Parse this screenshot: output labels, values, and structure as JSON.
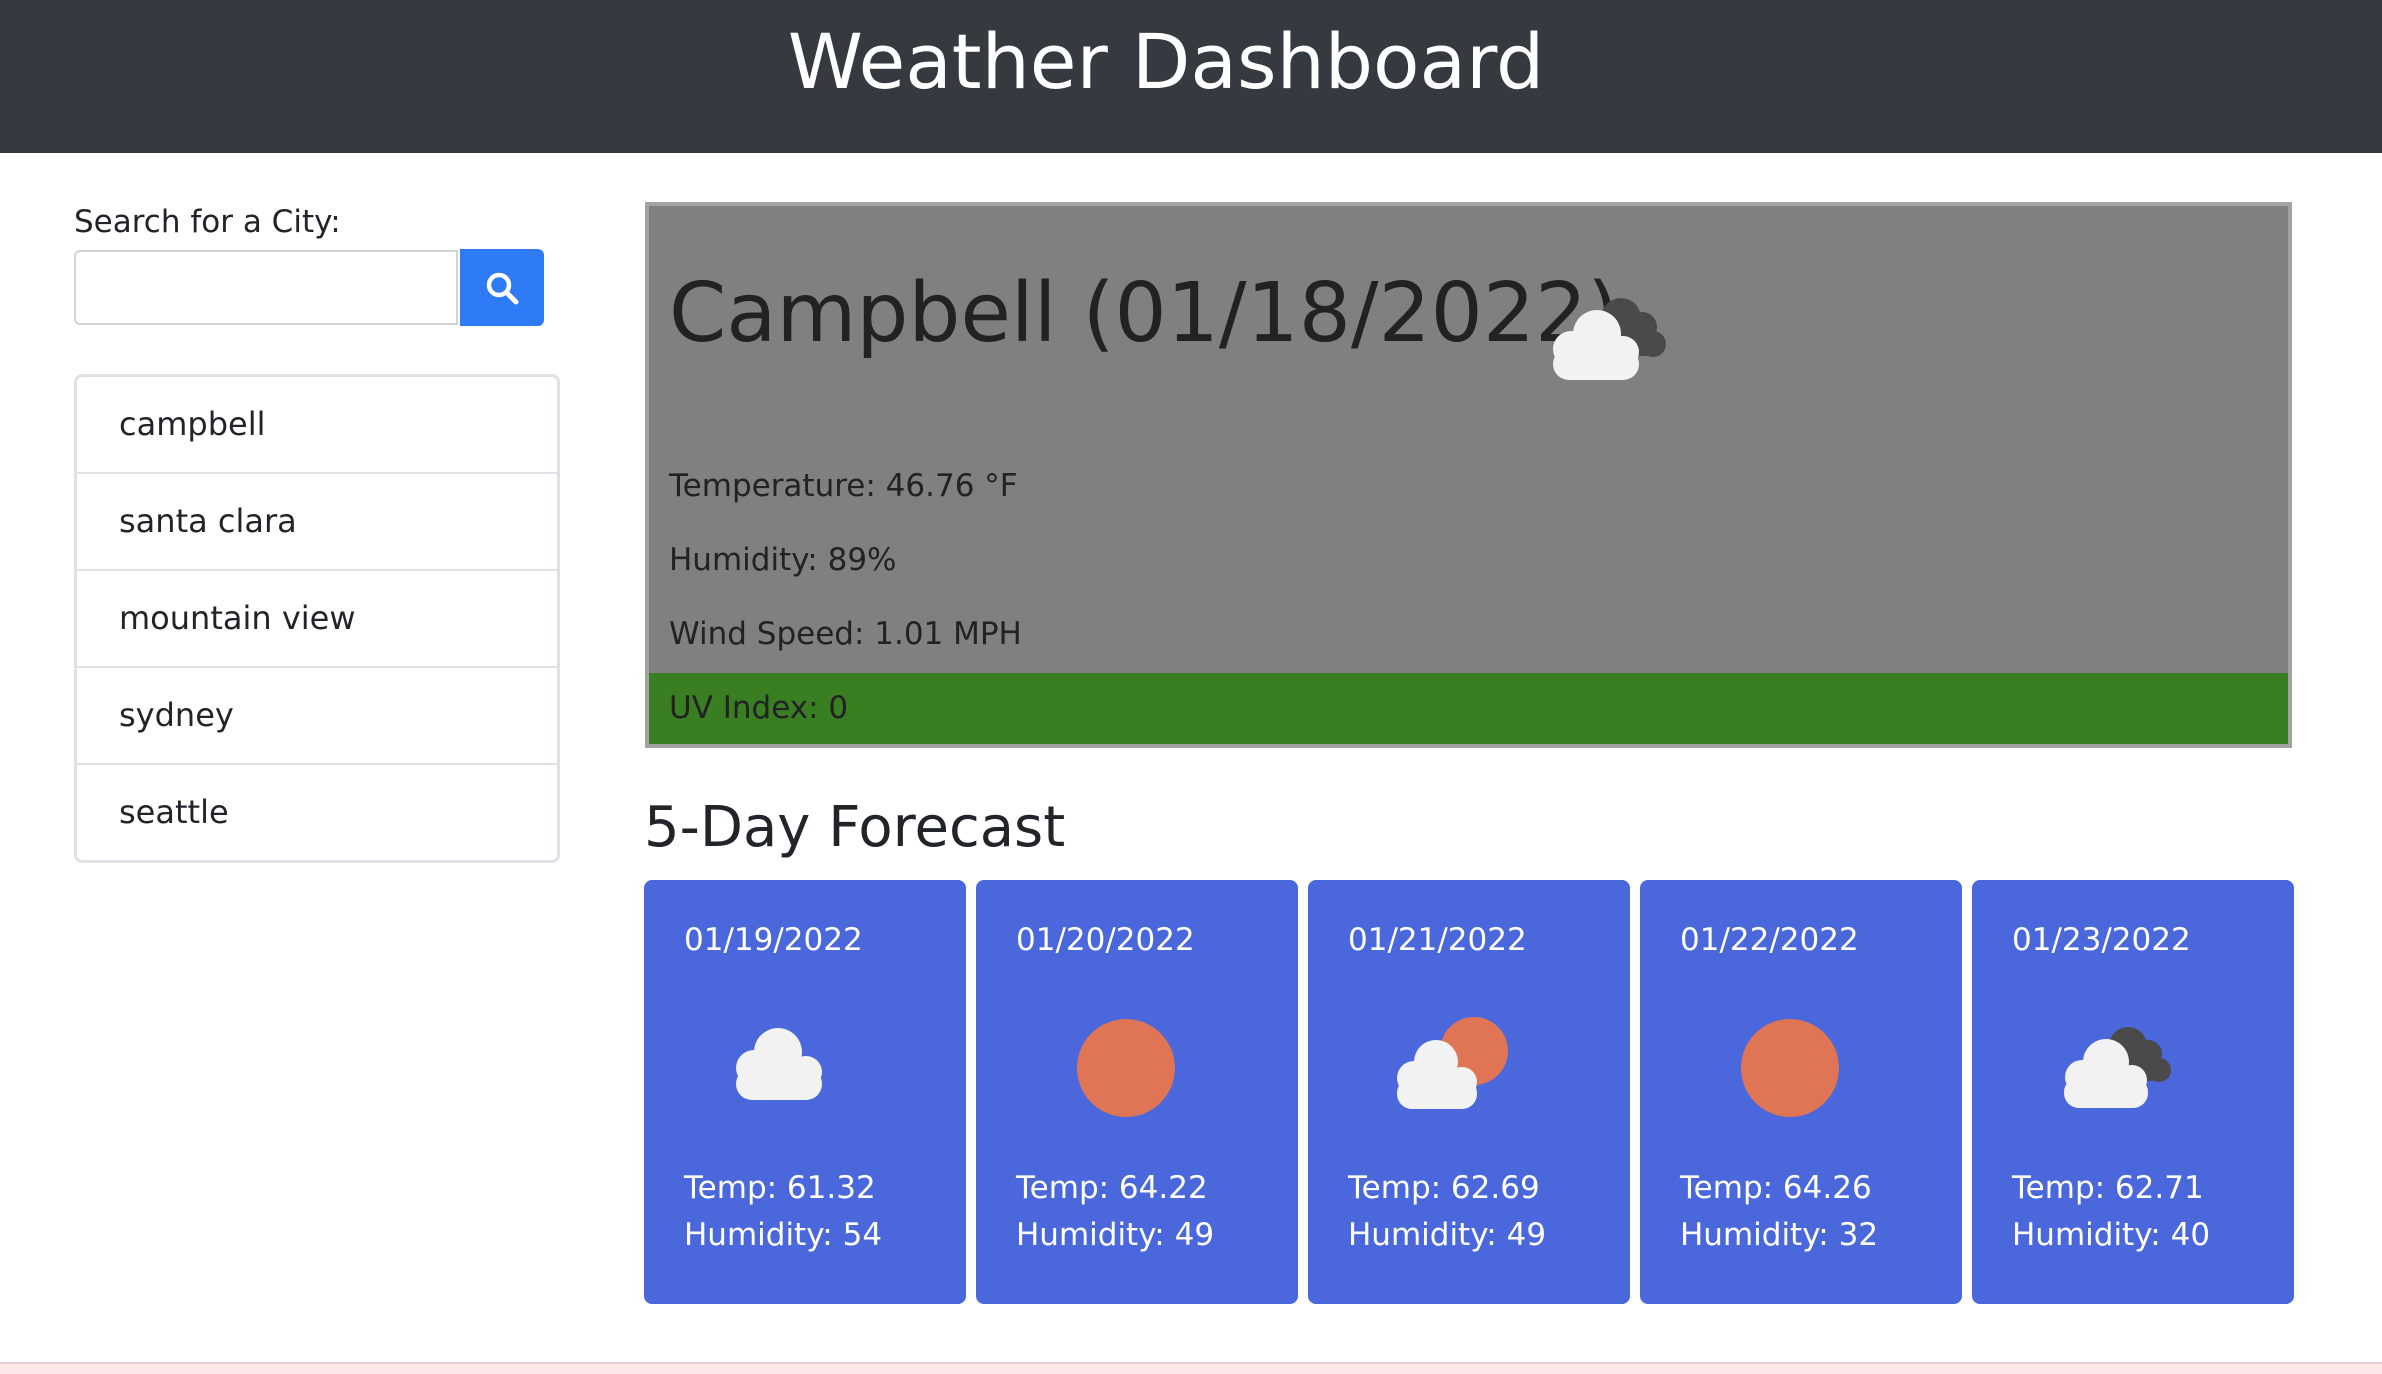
{
  "header": {
    "title": "Weather Dashboard"
  },
  "search": {
    "label": "Search for a City:",
    "placeholder": "",
    "value": "",
    "button_icon": "search-icon"
  },
  "history": [
    "campbell",
    "santa clara",
    "mountain view",
    "sydney",
    "seattle"
  ],
  "current": {
    "title": "Campbell (01/18/2022)",
    "icon": "cloudy-icon",
    "temperature": "Temperature: 46.76 °F",
    "humidity": "Humidity: 89%",
    "wind": "Wind Speed: 1.01 MPH",
    "uv": "UV Index: 0"
  },
  "forecast": {
    "title": "5-Day Forecast",
    "days": [
      {
        "date": "01/19/2022",
        "icon": "cloud-icon",
        "temp": "Temp: 61.32",
        "humidity": "Humidity: 54"
      },
      {
        "date": "01/20/2022",
        "icon": "sun-icon",
        "temp": "Temp: 64.22",
        "humidity": "Humidity: 49"
      },
      {
        "date": "01/21/2022",
        "icon": "partly-cloudy-icon",
        "temp": "Temp: 62.69",
        "humidity": "Humidity: 49"
      },
      {
        "date": "01/22/2022",
        "icon": "sun-icon",
        "temp": "Temp: 64.26",
        "humidity": "Humidity: 32"
      },
      {
        "date": "01/23/2022",
        "icon": "cloudy-icon",
        "temp": "Temp: 62.71",
        "humidity": "Humidity: 40"
      }
    ]
  },
  "colors": {
    "header_bg": "#343a40",
    "search_button": "#2f7bf5",
    "current_bg": "#808080",
    "uv_low": "#3a7e22",
    "card_bg": "#4a67db",
    "sun": "#e07555",
    "cloud": "#f2f2f2",
    "dark_cloud": "#4a4a4a"
  }
}
